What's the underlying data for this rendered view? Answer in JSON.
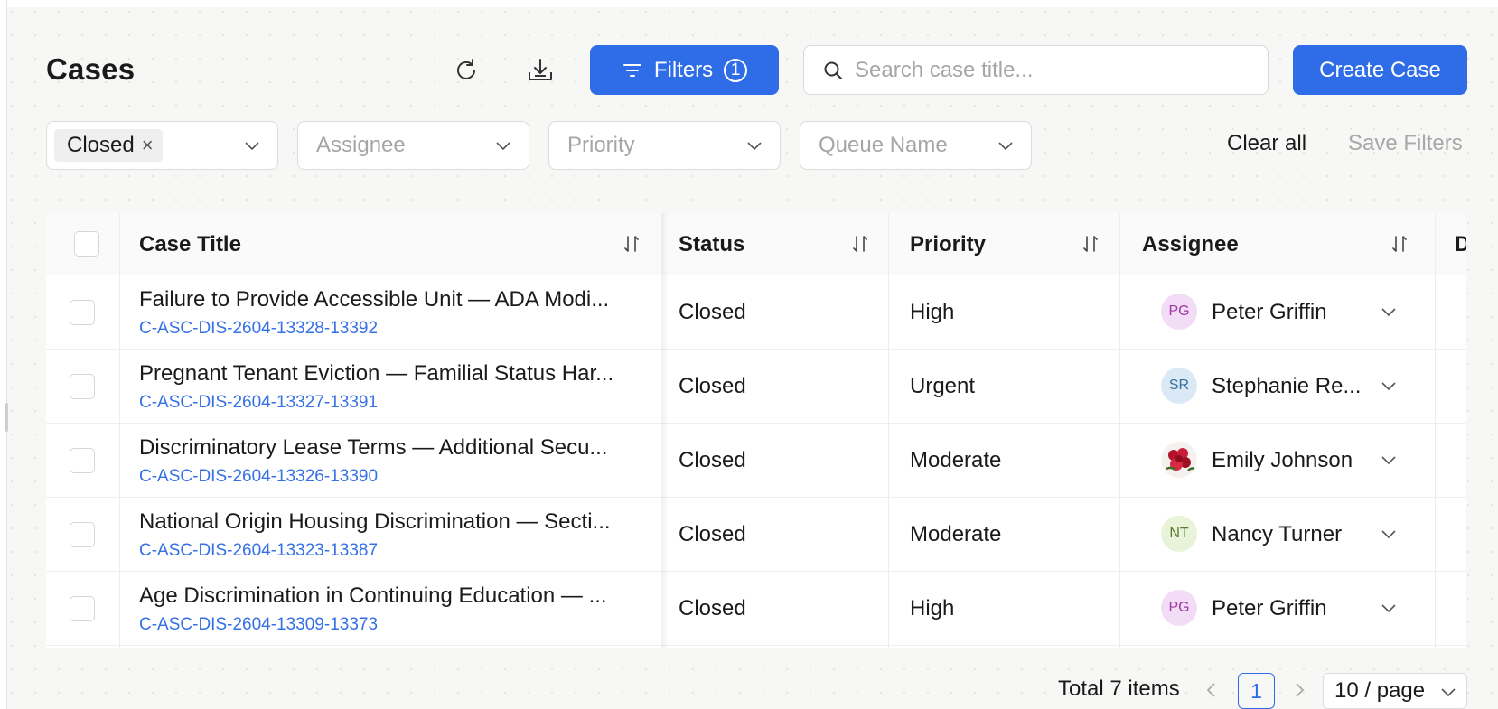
{
  "page": {
    "title": "Cases"
  },
  "toolbar": {
    "refresh_icon": "refresh-icon",
    "download_icon": "download-icon",
    "filters_label": "Filters",
    "filters_count": "1",
    "search_placeholder": "Search case title...",
    "create_label": "Create Case"
  },
  "filters": {
    "status_tag": "Closed",
    "assignee_placeholder": "Assignee",
    "priority_placeholder": "Priority",
    "queue_placeholder": "Queue Name",
    "clear_all": "Clear all",
    "save_filters": "Save Filters"
  },
  "table": {
    "columns": [
      "Case Title",
      "Status",
      "Priority",
      "Assignee",
      "D"
    ],
    "rows": [
      {
        "title": "Failure to Provide Accessible Unit — ADA Modi...",
        "id": "C-ASC-DIS-2604-13328-13392",
        "status": "Closed",
        "priority": "High",
        "initials": "PG",
        "assignee": "Peter Griffin"
      },
      {
        "title": "Pregnant Tenant Eviction — Familial Status Har...",
        "id": "C-ASC-DIS-2604-13327-13391",
        "status": "Closed",
        "priority": "Urgent",
        "initials": "SR",
        "assignee": "Stephanie Re..."
      },
      {
        "title": "Discriminatory Lease Terms — Additional Secu...",
        "id": "C-ASC-DIS-2604-13326-13390",
        "status": "Closed",
        "priority": "Moderate",
        "initials": "",
        "assignee": "Emily Johnson"
      },
      {
        "title": "National Origin Housing Discrimination — Secti...",
        "id": "C-ASC-DIS-2604-13323-13387",
        "status": "Closed",
        "priority": "Moderate",
        "initials": "NT",
        "assignee": "Nancy Turner"
      },
      {
        "title": "Age Discrimination in Continuing Education — ...",
        "id": "C-ASC-DIS-2604-13309-13373",
        "status": "Closed",
        "priority": "High",
        "initials": "PG",
        "assignee": "Peter Griffin"
      }
    ]
  },
  "pagination": {
    "total": "Total 7 items",
    "current_page": "1",
    "page_size": "10 / page"
  },
  "colors": {
    "accent": "#2f6de8",
    "link": "#3470e6",
    "avatar_pg_bg": "#f3dcf5",
    "avatar_pg_fg": "#9c3aa6",
    "avatar_sr_bg": "#dbe9f7",
    "avatar_sr_fg": "#3a6f9c",
    "avatar_nt_bg": "#e9f3d9",
    "avatar_nt_fg": "#5b7a2e"
  }
}
